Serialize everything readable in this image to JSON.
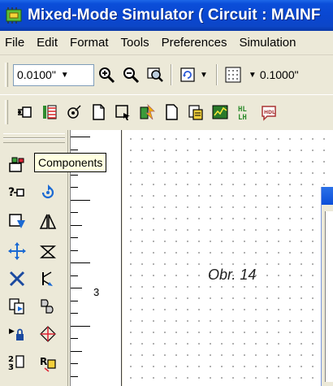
{
  "window": {
    "title": "Mixed-Mode Simulator ( Circuit : MAINF"
  },
  "menu": {
    "items": [
      "File",
      "Edit",
      "Format",
      "Tools",
      "Preferences",
      "Simulation"
    ]
  },
  "toolbar": {
    "grid_size": "0.0100\"",
    "grid_spacing": "0.1000\"",
    "icons": [
      "zoom-in-icon",
      "zoom-out-icon",
      "zoom-area-icon",
      "refresh-icon",
      "grid-dots-icon"
    ]
  },
  "toolbar2": {
    "icons": [
      "place-part-icon",
      "library-icon",
      "probe-icon",
      "new-page-icon",
      "select-area-icon",
      "netlist-icon",
      "document-icon",
      "component-editor-icon",
      "chart-icon",
      "hl-lh-icon",
      "hdl-icon"
    ]
  },
  "tooltip": {
    "text": "Components"
  },
  "ruler": {
    "label": "3"
  },
  "canvas": {
    "caption": "Obr. 14"
  },
  "colors": {
    "titlebar": "#0a47d1",
    "tooltip_bg": "#ffffe1",
    "canvas_bg": "#ffffff"
  }
}
